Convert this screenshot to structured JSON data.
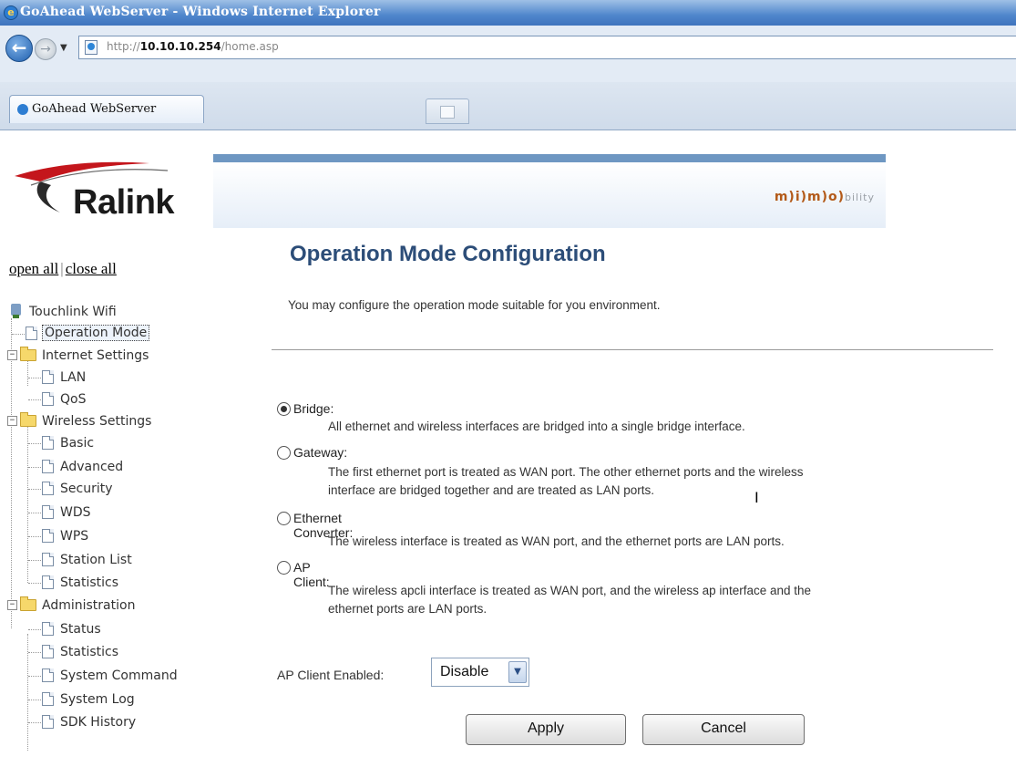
{
  "window": {
    "title": "GoAhead WebServer - Windows Internet Explorer"
  },
  "browser": {
    "url_prefix": "http://",
    "url_host": "10.10.10.254",
    "url_path": "/home.asp",
    "tab_title": "GoAhead WebServer"
  },
  "brand": {
    "logo_text": "Ralink",
    "banner_text_main": "m)i)m)o)",
    "banner_text_tail": "bility"
  },
  "sidebar": {
    "open_all": "open all",
    "separator": "|",
    "close_all": "close all",
    "root": "Touchlink Wifi",
    "operation_mode": "Operation Mode",
    "groups": [
      {
        "label": "Internet Settings",
        "items": [
          "LAN",
          "QoS"
        ]
      },
      {
        "label": "Wireless Settings",
        "items": [
          "Basic",
          "Advanced",
          "Security",
          "WDS",
          "WPS",
          "Station List",
          "Statistics"
        ]
      },
      {
        "label": "Administration",
        "items": [
          "Status",
          "Statistics",
          "System Command",
          "System Log",
          "SDK History"
        ]
      }
    ]
  },
  "main": {
    "title": "Operation Mode Configuration",
    "description": "You may configure the operation mode suitable for you environment.",
    "options": [
      {
        "label": "Bridge:",
        "selected": true,
        "desc": [
          "All ethernet and wireless interfaces are bridged into a single bridge interface."
        ]
      },
      {
        "label": "Gateway:",
        "selected": false,
        "desc": [
          "The first ethernet port is treated as WAN port. The other ethernet ports and the wireless",
          "interface are bridged together and are treated as LAN ports."
        ]
      },
      {
        "label": "Ethernet Converter:",
        "selected": false,
        "desc": [
          "The wireless interface is treated as WAN port, and the ethernet ports are LAN ports."
        ]
      },
      {
        "label": "AP Client:",
        "selected": false,
        "desc": [
          "The wireless apcli interface is treated as WAN port, and the wireless ap interface and the",
          "ethernet ports are LAN ports."
        ]
      }
    ],
    "ap_client_label": "AP Client Enabled:",
    "ap_client_value": "Disable",
    "apply_label": "Apply",
    "cancel_label": "Cancel"
  }
}
